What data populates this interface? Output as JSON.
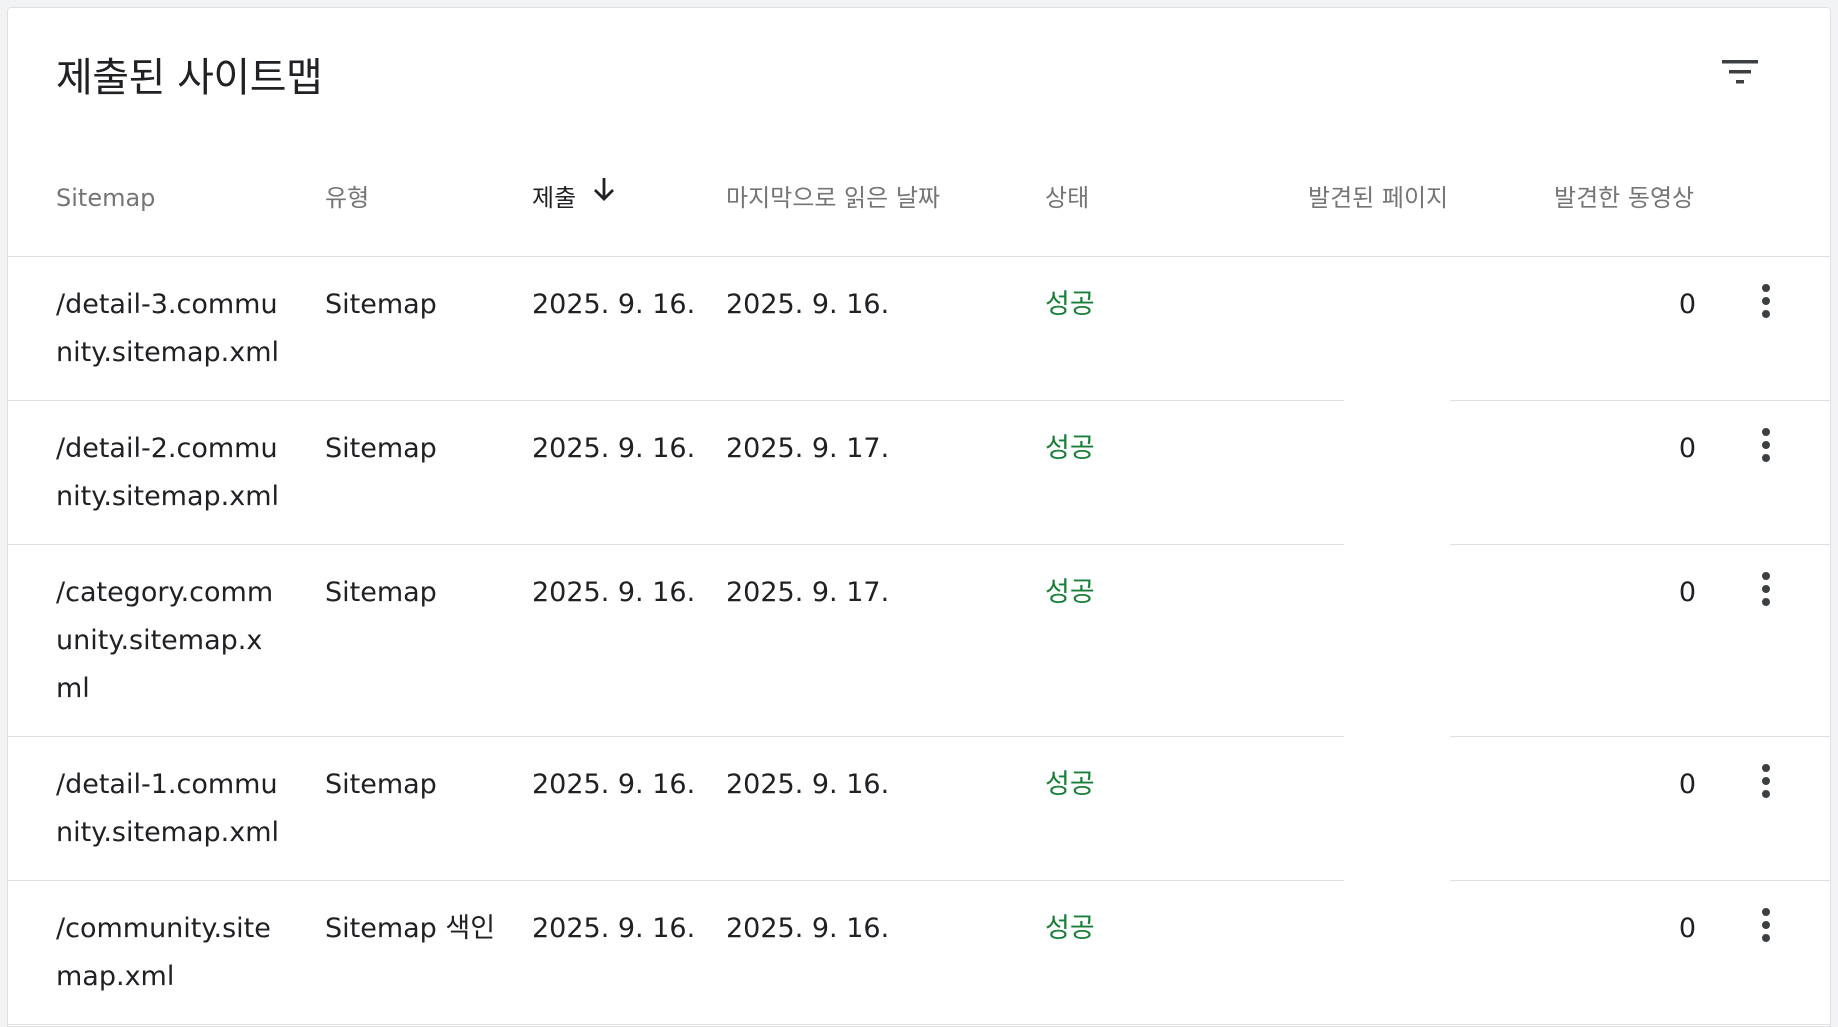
{
  "title": "제출된 사이트맵",
  "columns": {
    "sitemap": "Sitemap",
    "type": "유형",
    "submitted": "제출",
    "last_read": "마지막으로 읽은 날짜",
    "status": "상태",
    "discovered_pages": "발견된 페이지",
    "discovered_videos": "발견한 동영상"
  },
  "rows": [
    {
      "sitemap": "/detail-3.community.sitemap.xml",
      "type": "Sitemap",
      "submitted": "2025. 9. 16.",
      "last_read": "2025. 9. 16.",
      "status": "성공",
      "pages": "",
      "videos": "0"
    },
    {
      "sitemap": "/detail-2.community.sitemap.xml",
      "type": "Sitemap",
      "submitted": "2025. 9. 16.",
      "last_read": "2025. 9. 17.",
      "status": "성공",
      "pages": "",
      "videos": "0"
    },
    {
      "sitemap": "/category.community.sitemap.xml",
      "type": "Sitemap",
      "submitted": "2025. 9. 16.",
      "last_read": "2025. 9. 17.",
      "status": "성공",
      "pages": "",
      "videos": "0"
    },
    {
      "sitemap": "/detail-1.community.sitemap.xml",
      "type": "Sitemap",
      "submitted": "2025. 9. 16.",
      "last_read": "2025. 9. 16.",
      "status": "성공",
      "pages": "",
      "videos": "0"
    },
    {
      "sitemap": "/community.sitemap.xml",
      "type": "Sitemap 색인",
      "submitted": "2025. 9. 16.",
      "last_read": "2025. 9. 16.",
      "status": "성공",
      "pages": "",
      "videos": "0"
    }
  ],
  "icons": {
    "filter": "filter-icon",
    "sort": "arrow-down-icon",
    "more": "more-vert-icon"
  },
  "colors": {
    "success": "#188038",
    "header_text": "#757575",
    "text": "#202124"
  }
}
